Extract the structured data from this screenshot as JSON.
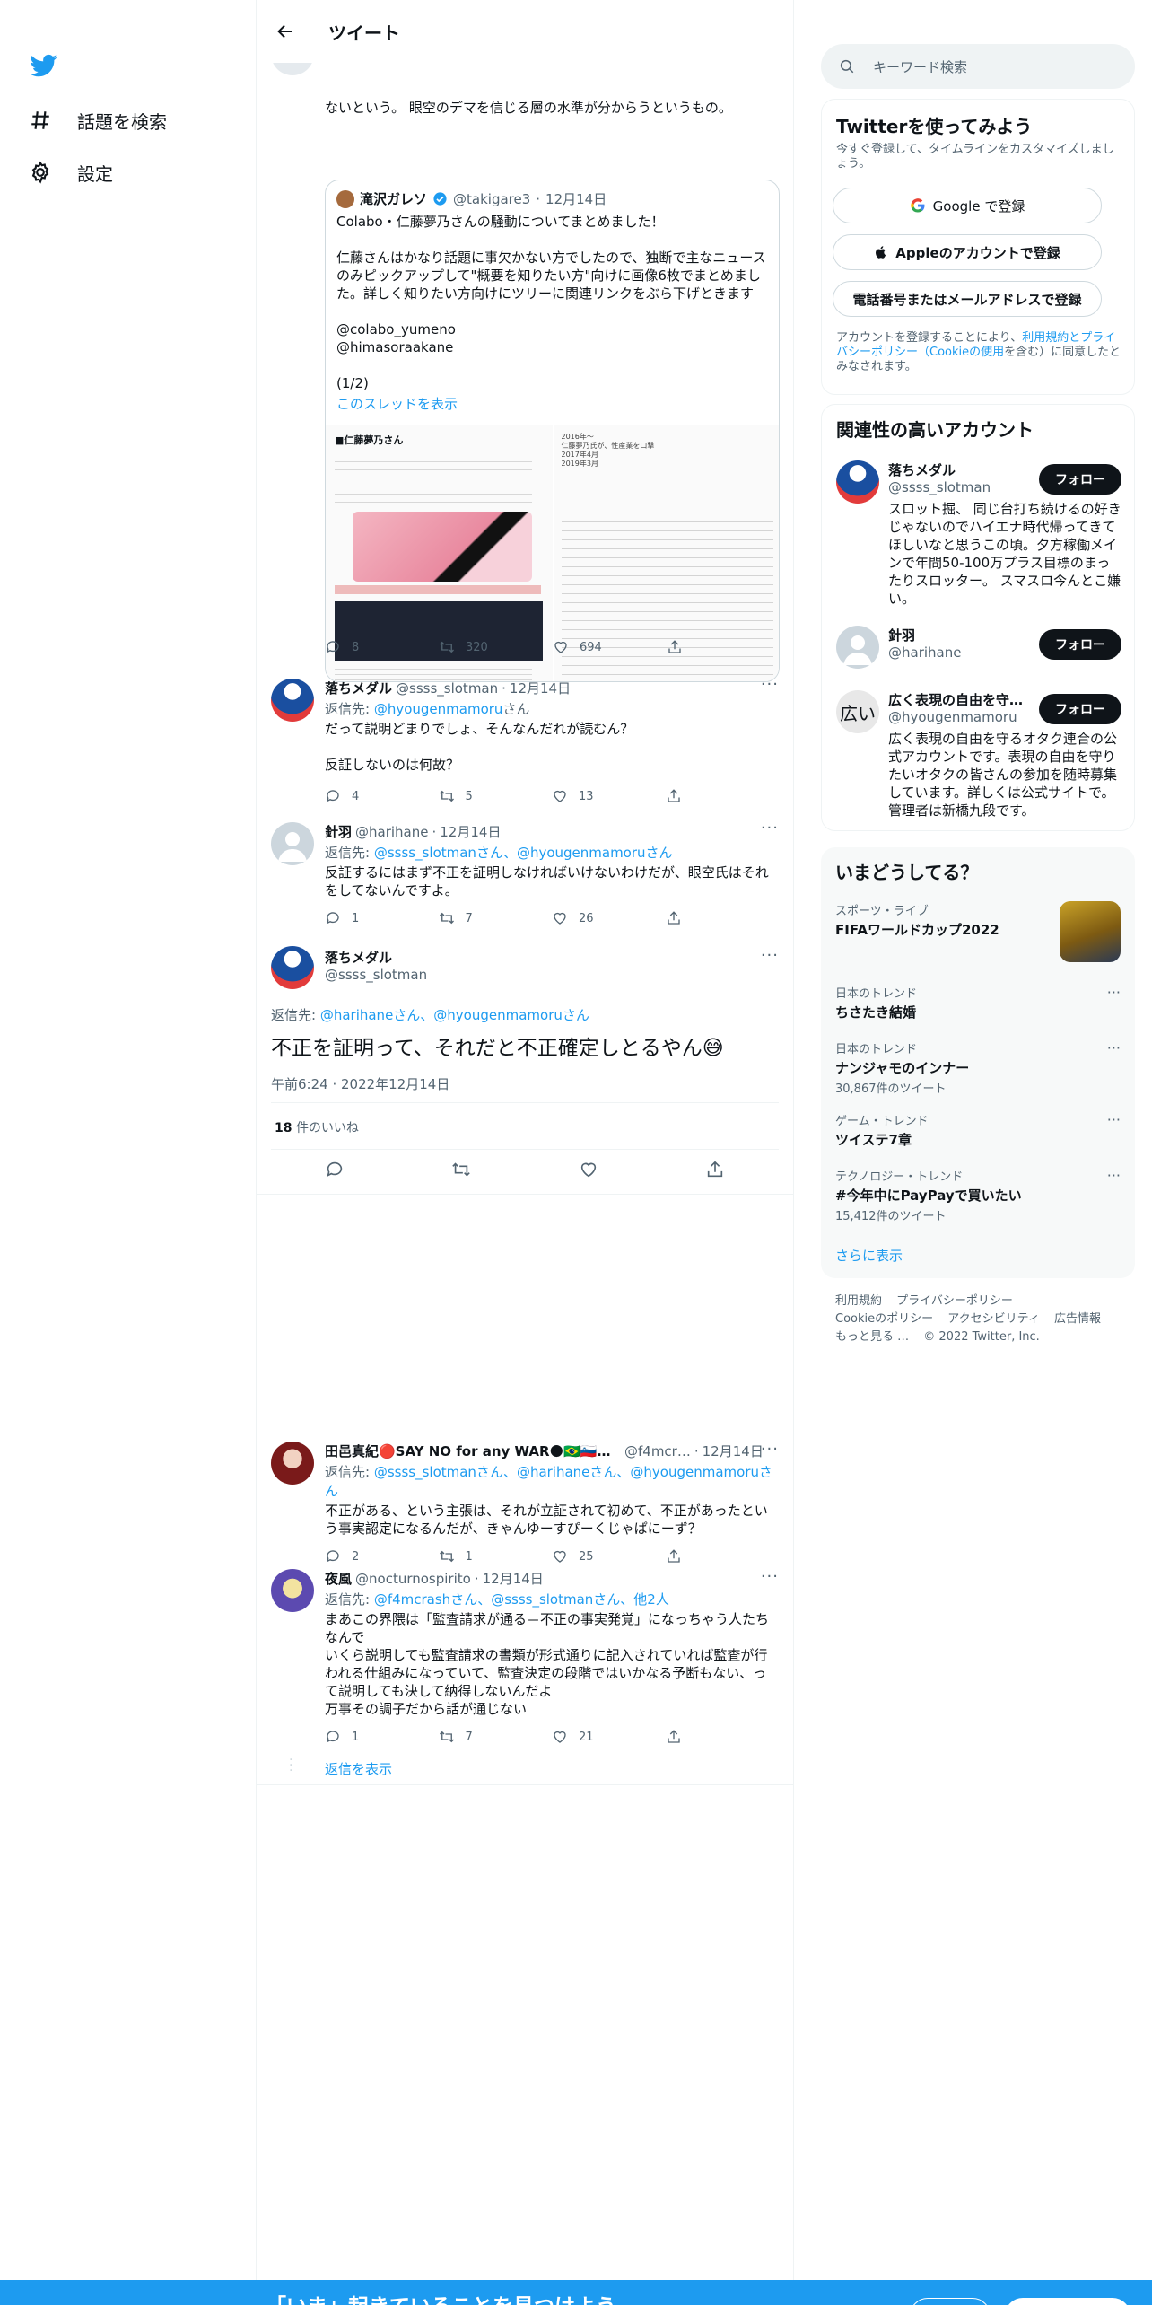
{
  "nav": {
    "explore": "話題を検索",
    "settings": "設定"
  },
  "header": {
    "title": "ツイート"
  },
  "top_tweet": {
    "text": "ないという。 眼空のデマを信じる層の水準が分からうというもの。",
    "quote": {
      "name": "滝沢ガレソ",
      "handle": "@takigare3",
      "date": "12月14日",
      "text": "Colabo・仁藤夢乃さんの騒動についてまとめました！\n\n仁藤さんはかなり話題に事欠かない方でしたので、独断で主なニュースのみピックアップして\"概要を知りたい方\"向けに画像6枚でまとめました。詳しく知りたい方向けにツリーに関連リンクをぶら下げときます\n\n@colabo_yumeno\n@himasoraakane\n\n(1/2)",
      "thread_link": "このスレッドを表示",
      "image1_title": "■仁藤夢乃さん",
      "image2_lines": "2016年〜\n仁藤夢乃氏が、性産業を口撃\n2017年4月\n2019年3月"
    },
    "counts": {
      "reply": "8",
      "retweet": "320",
      "like": "694"
    }
  },
  "replies": [
    {
      "name": "落ちメダル",
      "handle": "@ssss_slotman",
      "date": "12月14日",
      "reply_to_prefix": "返信先: ",
      "reply_to_links": "@hyougenmamoru",
      "reply_to_suffix": "さん",
      "text": "だって説明どまりでしょ、そんなんだれが読むん？\n\n反証しないのは何故？",
      "counts": {
        "reply": "4",
        "retweet": "5",
        "like": "13"
      }
    },
    {
      "name": "針羽",
      "handle": "@harihane",
      "date": "12月14日",
      "reply_to_prefix": "返信先: ",
      "reply_to_links": "@ssss_slotmanさん、@hyougenmamoruさん",
      "text": "反証するにはまず不正を証明しなければいけないわけだが、眼空氏はそれをしてないんですよ。",
      "counts": {
        "reply": "1",
        "retweet": "7",
        "like": "26"
      }
    }
  ],
  "focal": {
    "name": "落ちメダル",
    "handle": "@ssss_slotman",
    "reply_to_prefix": "返信先: ",
    "reply_to_links": "@harihaneさん、@hyougenmamoruさん",
    "text": "不正を証明って、それだと不正確定しとるやん",
    "emoji": "😅",
    "timestamp": "午前6:24 · 2022年12月14日",
    "likes_count": "18",
    "likes_label": "件のいいね"
  },
  "later_replies": [
    {
      "name": "田邑真紀🔴SAY NO for any WAR🌑🇧🇷🇸🇮🇰🇷…",
      "handle": "@f4mcr…",
      "date": "12月14日",
      "reply_to_prefix": "返信先: ",
      "reply_to_links": "@ssss_slotmanさん、@harihaneさん、@hyougenmamoruさん",
      "text": "不正がある、という主張は、それが立証されて初めて、不正があったという事実認定になるんだが、きゃんゆーすぴーくじゃぱにーず？",
      "counts": {
        "reply": "2",
        "retweet": "1",
        "like": "25"
      }
    },
    {
      "name": "夜風",
      "handle": "@nocturnospirito",
      "date": "12月14日",
      "reply_to_prefix": "返信先: ",
      "reply_to_links": "@f4mcrashさん、@ssss_slotmanさん、他2人",
      "text": "まあこの界隈は「監査請求が通る＝不正の事実発覚」になっちゃう人たちなんで\nいくら説明しても監査請求の書類が形式通りに記入されていれば監査が行われる仕組みになっていて、監査決定の段階ではいかなる予断もない、って説明しても決して納得しないんだよ\n万事その調子だから話が通じない",
      "counts": {
        "reply": "1",
        "retweet": "7",
        "like": "21"
      }
    }
  ],
  "show_replies": "返信を表示",
  "search": {
    "placeholder": "キーワード検索"
  },
  "signup": {
    "title": "Twitterを使ってみよう",
    "subtitle": "今すぐ登録して、タイムラインをカスタマイズしましょう。",
    "google": "Google で登録",
    "apple": "Appleのアカウントで登録",
    "phone": "電話番号またはメールアドレスで登録",
    "terms_prefix": "アカウントを登録することにより、",
    "terms_link": "利用規約とプライバシーポリシー（Cookieの使用",
    "terms_suffix": "を含む）に同意したとみなされます。"
  },
  "relevant": {
    "title": "関連性の高いアカウント",
    "follow_label": "フォロー",
    "accounts": [
      {
        "name": "落ちメダル",
        "handle": "@ssss_slotman",
        "bio": "スロット掘、 同じ台打ち続けるの好きじゃないのでハイエナ時代帰ってきてほしいなと思うこの頃。夕方稼働メインで年間50-100万プラス目標のまったりスロッター。 スマスロ今んとこ嫌い。"
      },
      {
        "name": "針羽",
        "handle": "@harihane",
        "bio": ""
      },
      {
        "name": "広く表現の自由を守…",
        "handle": "@hyougenmamoru",
        "bio": "広く表現の自由を守るオタク連合の公式アカウントです。表現の自由を守りたいオタクの皆さんの参加を随時募集しています。詳しくは公式サイトで。管理者は新橋九段です。",
        "avatar_text": "広い"
      }
    ]
  },
  "trends": {
    "title": "いまどうしてる？",
    "items": [
      {
        "category": "スポーツ・ライブ",
        "name": "FIFAワールドカップ2022",
        "count": ""
      },
      {
        "category": "日本のトレンド",
        "name": "ちさたき結婚",
        "count": ""
      },
      {
        "category": "日本のトレンド",
        "name": "ナンジャモのインナー",
        "count": "30,867件のツイート"
      },
      {
        "category": "ゲーム・トレンド",
        "name": "ツイステ7章",
        "count": ""
      },
      {
        "category": "テクノロジー・トレンド",
        "name": "#今年中にPayPayで買いたい",
        "count": "15,412件のツイート"
      }
    ],
    "show_more": "さらに表示"
  },
  "footer": {
    "links": [
      "利用規約",
      "プライバシーポリシー",
      "Cookieのポリシー",
      "アクセシビリティ",
      "広告情報",
      "もっと見る …"
    ],
    "copyright": "© 2022 Twitter, Inc."
  },
  "bottom_bar": {
    "message": "「いま」起きていることを見つけよう"
  },
  "colors": {
    "accent": "#1d9bf0",
    "text": "#0f1419",
    "secondary": "#536471",
    "verified": "#1d9bf0"
  }
}
